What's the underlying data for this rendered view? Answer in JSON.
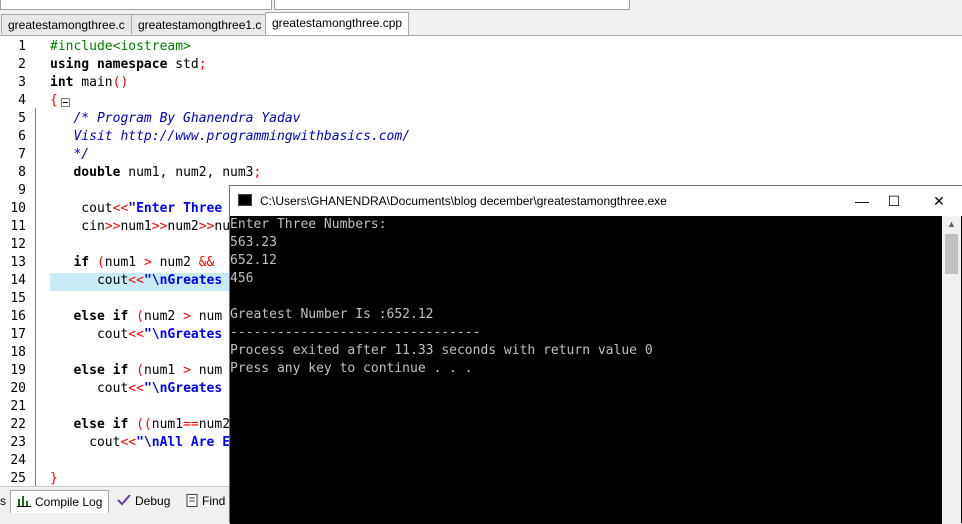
{
  "tabs": [
    {
      "label": "greatestamongthree.c",
      "active": false
    },
    {
      "label": "greatestamongthree1.c",
      "active": false
    },
    {
      "label": "greatestamongthree.cpp",
      "active": true
    }
  ],
  "code_lines": [
    {
      "n": "1",
      "spans": [
        {
          "t": "#include<iostream>",
          "c": "pp"
        }
      ]
    },
    {
      "n": "2",
      "spans": [
        {
          "t": "using namespace",
          "c": "kw"
        },
        {
          "t": " std",
          "c": ""
        },
        {
          "t": ";",
          "c": "op"
        }
      ]
    },
    {
      "n": "3",
      "spans": [
        {
          "t": "int",
          "c": "kw"
        },
        {
          "t": " main",
          "c": ""
        },
        {
          "t": "()",
          "c": "op"
        }
      ]
    },
    {
      "n": "4",
      "spans": [
        {
          "t": "{",
          "c": "op"
        }
      ]
    },
    {
      "n": "5",
      "spans": [
        {
          "t": "   /* Program By Ghanendra Yadav",
          "c": "cm"
        }
      ]
    },
    {
      "n": "6",
      "spans": [
        {
          "t": "   Visit http://www.programmingwithbasics.com/",
          "c": "cm"
        }
      ]
    },
    {
      "n": "7",
      "spans": [
        {
          "t": "   */",
          "c": "cm"
        }
      ]
    },
    {
      "n": "8",
      "spans": [
        {
          "t": "   ",
          "c": ""
        },
        {
          "t": "double",
          "c": "kw"
        },
        {
          "t": " num1, num2, num3",
          "c": ""
        },
        {
          "t": ";",
          "c": "op"
        }
      ]
    },
    {
      "n": "9",
      "spans": []
    },
    {
      "n": "10",
      "spans": [
        {
          "t": "    cout",
          "c": ""
        },
        {
          "t": "<<",
          "c": "op"
        },
        {
          "t": "\"Enter Three",
          "c": "st"
        }
      ]
    },
    {
      "n": "11",
      "spans": [
        {
          "t": "    cin",
          "c": ""
        },
        {
          "t": ">>",
          "c": "op"
        },
        {
          "t": "num1",
          "c": ""
        },
        {
          "t": ">>",
          "c": "op"
        },
        {
          "t": "num2",
          "c": ""
        },
        {
          "t": ">>",
          "c": "op"
        },
        {
          "t": "nu",
          "c": ""
        }
      ]
    },
    {
      "n": "12",
      "spans": []
    },
    {
      "n": "13",
      "spans": [
        {
          "t": "   ",
          "c": ""
        },
        {
          "t": "if",
          "c": "kw"
        },
        {
          "t": " ",
          "c": ""
        },
        {
          "t": "(",
          "c": "op"
        },
        {
          "t": "num1 ",
          "c": ""
        },
        {
          "t": ">",
          "c": "op"
        },
        {
          "t": " num2 ",
          "c": ""
        },
        {
          "t": "&&",
          "c": "op"
        }
      ]
    },
    {
      "n": "14",
      "spans": [
        {
          "t": "      cout",
          "c": ""
        },
        {
          "t": "<<",
          "c": "op"
        },
        {
          "t": "\"\\nGreates",
          "c": "st"
        }
      ]
    },
    {
      "n": "15",
      "spans": []
    },
    {
      "n": "16",
      "spans": [
        {
          "t": "   ",
          "c": ""
        },
        {
          "t": "else if",
          "c": "kw"
        },
        {
          "t": " ",
          "c": ""
        },
        {
          "t": "(",
          "c": "op"
        },
        {
          "t": "num2 ",
          "c": ""
        },
        {
          "t": ">",
          "c": "op"
        },
        {
          "t": " num",
          "c": ""
        }
      ]
    },
    {
      "n": "17",
      "spans": [
        {
          "t": "      cout",
          "c": ""
        },
        {
          "t": "<<",
          "c": "op"
        },
        {
          "t": "\"\\nGreates",
          "c": "st"
        }
      ]
    },
    {
      "n": "18",
      "spans": []
    },
    {
      "n": "19",
      "spans": [
        {
          "t": "   ",
          "c": ""
        },
        {
          "t": "else if",
          "c": "kw"
        },
        {
          "t": " ",
          "c": ""
        },
        {
          "t": "(",
          "c": "op"
        },
        {
          "t": "num1 ",
          "c": ""
        },
        {
          "t": ">",
          "c": "op"
        },
        {
          "t": " num",
          "c": ""
        }
      ]
    },
    {
      "n": "20",
      "spans": [
        {
          "t": "      cout",
          "c": ""
        },
        {
          "t": "<<",
          "c": "op"
        },
        {
          "t": "\"\\nGreates",
          "c": "st"
        }
      ]
    },
    {
      "n": "21",
      "spans": []
    },
    {
      "n": "22",
      "spans": [
        {
          "t": "   ",
          "c": ""
        },
        {
          "t": "else if",
          "c": "kw"
        },
        {
          "t": " ",
          "c": ""
        },
        {
          "t": "((",
          "c": "op"
        },
        {
          "t": "num1",
          "c": ""
        },
        {
          "t": "==",
          "c": "op"
        },
        {
          "t": "num2",
          "c": ""
        }
      ]
    },
    {
      "n": "23",
      "spans": [
        {
          "t": "     cout",
          "c": ""
        },
        {
          "t": "<<",
          "c": "op"
        },
        {
          "t": "\"\\nAll Are E",
          "c": "st"
        }
      ]
    },
    {
      "n": "24",
      "spans": []
    },
    {
      "n": "25",
      "spans": [
        {
          "t": "}",
          "c": "op"
        }
      ]
    }
  ],
  "bottom_tabs": [
    {
      "label": "Compile Log",
      "icon": "bar-chart-icon",
      "active": true
    },
    {
      "label": "Debug",
      "icon": "check-icon",
      "active": false
    },
    {
      "label": "Find",
      "icon": "document-icon",
      "active": false
    }
  ],
  "console": {
    "title": "C:\\Users\\GHANENDRA\\Documents\\blog december\\greatestamongthree.exe",
    "minimize": "—",
    "maximize": "☐",
    "close": "✕",
    "lines": [
      "Enter Three Numbers:",
      "563.23",
      "652.12",
      "456",
      "",
      "Greatest Number Is :652.12",
      "--------------------------------",
      "Process exited after 11.33 seconds with return value 0",
      "Press any key to continue . . ."
    ]
  }
}
